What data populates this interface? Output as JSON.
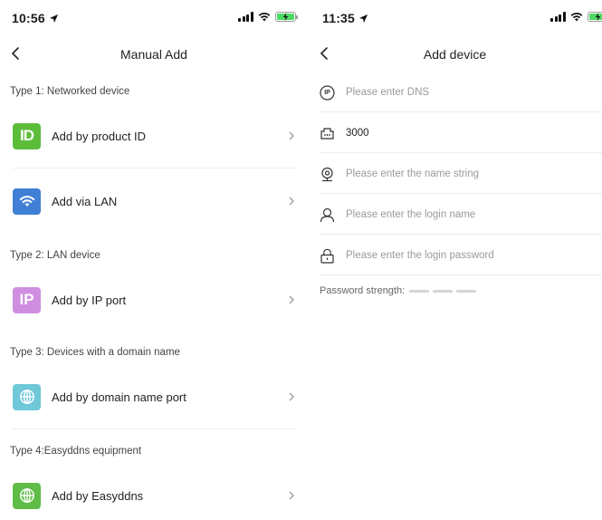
{
  "left": {
    "status": {
      "time": "10:56"
    },
    "title": "Manual Add",
    "sections": [
      {
        "label": "Type 1: Networked device"
      },
      {
        "label": "Type 2: LAN device"
      },
      {
        "label": "Type 3: Devices with a domain name"
      },
      {
        "label": "Type 4:Easyddns equipment"
      }
    ],
    "items": [
      {
        "label": "Add by product ID",
        "icon": "id-icon",
        "icon_text": "ID",
        "color": "#5dbd3b"
      },
      {
        "label": "Add via LAN",
        "icon": "wifi-icon",
        "color": "#3f7fd6"
      },
      {
        "label": "Add by IP port",
        "icon": "ip-icon",
        "icon_text": "IP",
        "color": "#cf8ee0"
      },
      {
        "label": "Add by domain name port",
        "icon": "globe-icon",
        "color": "#6ec8d8"
      },
      {
        "label": "Add by Easyddns",
        "icon": "globe-icon",
        "color": "#5fbd47"
      }
    ]
  },
  "right": {
    "status": {
      "time": "11:35"
    },
    "title": "Add device",
    "fields": [
      {
        "icon": "ip-circle-icon",
        "icon_text": "IP",
        "value": "",
        "placeholder": "Please enter DNS"
      },
      {
        "icon": "port-icon",
        "value": "3000",
        "placeholder": ""
      },
      {
        "icon": "camera-icon",
        "value": "",
        "placeholder": "Please enter the name string"
      },
      {
        "icon": "user-icon",
        "value": "",
        "placeholder": "Please enter the login name"
      },
      {
        "icon": "lock-icon",
        "value": "",
        "placeholder": "Please enter the login password"
      }
    ],
    "password_strength_label": "Password strength:"
  },
  "colors": {
    "battery": "#4cd964",
    "text": "#222222",
    "placeholder": "#9a9a9a",
    "divider": "#ededed"
  }
}
